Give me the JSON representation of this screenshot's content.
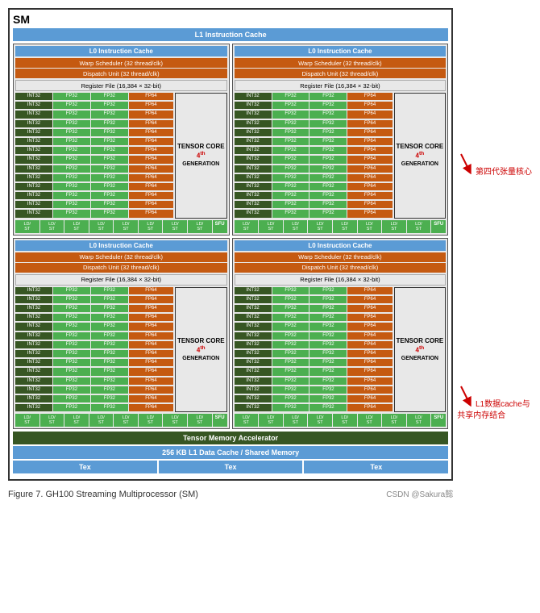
{
  "sm_label": "SM",
  "l1_instruction_cache": "L1 Instruction Cache",
  "l0_instruction_cache": "L0 Instruction Cache",
  "warp_scheduler": "Warp Scheduler (32 thread/clk)",
  "dispatch_unit": "Dispatch Unit (32 thread/clk)",
  "register_file": "Register File (16,384 × 32-bit)",
  "tensor_core": "TENSOR CORE",
  "tensor_gen": "4th GENERATION",
  "int32": "INT32",
  "fp32_a": "FP32",
  "fp32_b": "FP32",
  "fp64": "FP64",
  "ld_st": "LD/\nST",
  "sfu": "SFU",
  "tensor_memory_accelerator": "Tensor Memory Accelerator",
  "l1_data_cache": "256 KB L1 Data Cache / Shared Memory",
  "tex": "Tex",
  "figure_caption": "Figure 7.    GH100 Streaming Multiprocessor (SM)",
  "annotation1": "第四代张量核心",
  "annotation2": "L1数据cache与\n共享内存结合",
  "csdn_label": "CSDN @Sakura懿",
  "num_rows": 14
}
